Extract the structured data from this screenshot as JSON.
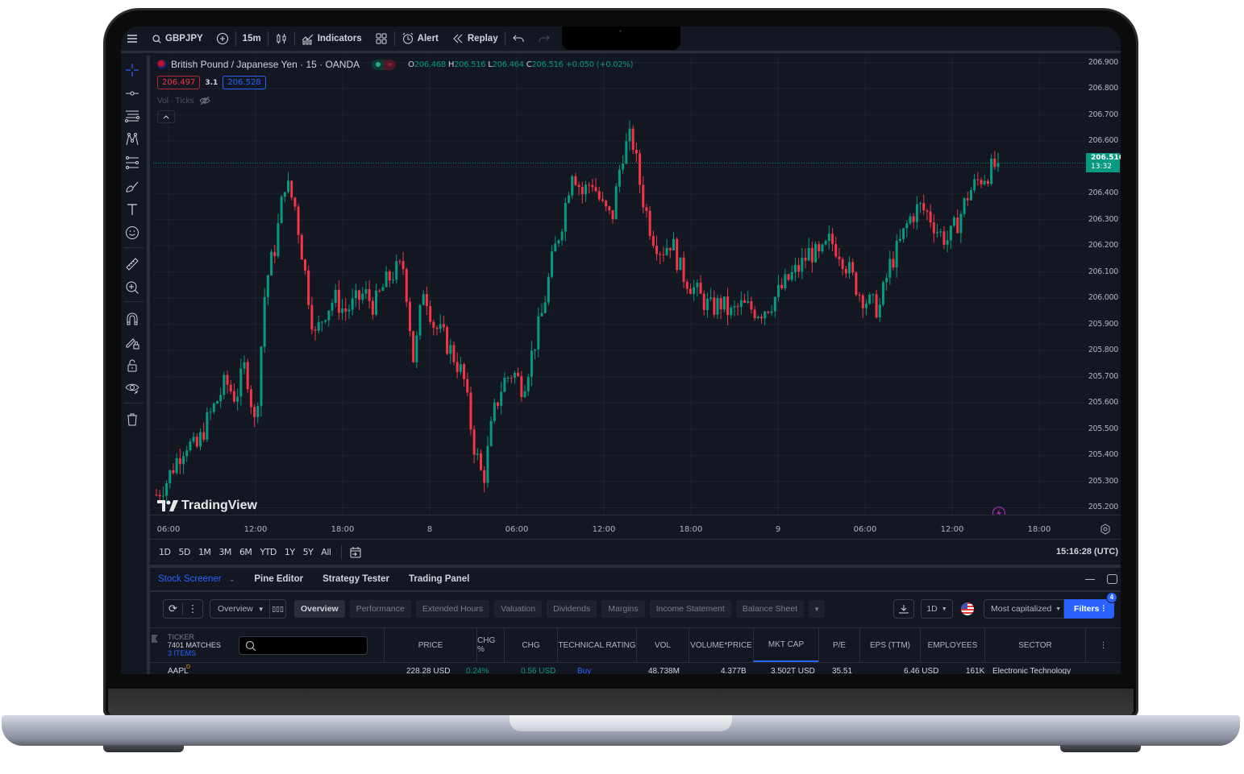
{
  "topbar": {
    "symbol": "GBPJPY",
    "interval": "15m",
    "indicators_label": "Indicators",
    "alert_label": "Alert",
    "replay_label": "Replay",
    "icons": [
      "menu-icon",
      "search-icon",
      "add-symbol-icon",
      "candles-icon",
      "indicators-icon",
      "layouts-icon",
      "alert-icon",
      "replay-icon",
      "undo-icon",
      "redo-icon"
    ]
  },
  "legend": {
    "title": "British Pound / Japanese Yen · 15 · OANDA",
    "ohlc": {
      "o_label": "O",
      "o": "206.468",
      "h_label": "H",
      "h": "206.516",
      "l_label": "L",
      "l": "206.464",
      "c_label": "C",
      "c": "206.516",
      "change": "+0.050 (+0.02%)"
    },
    "bid": "206.497",
    "spread": "3.1",
    "ask": "206.528",
    "volume_label": "Vol · Ticks"
  },
  "left_toolbar": {
    "icons": [
      "crosshair-icon",
      "horizontal-line-icon",
      "fib-icon",
      "pattern-icon",
      "projection-icon",
      "brush-icon",
      "text-icon",
      "emoji-icon",
      "ruler-icon",
      "zoom-in-icon",
      "magnet-icon",
      "lock-drawing-icon",
      "lock-icon",
      "eye-icon",
      "trash-icon"
    ]
  },
  "chart_data": {
    "type": "candlestick",
    "title": "British Pound / Japanese Yen · 15 · OANDA",
    "y_ticks": [
      "206.900",
      "206.800",
      "206.700",
      "206.600",
      "206.500",
      "206.400",
      "206.300",
      "206.200",
      "206.100",
      "206.000",
      "205.900",
      "205.800",
      "205.700",
      "205.600",
      "205.500",
      "205.400",
      "205.300",
      "205.200"
    ],
    "ylim": [
      205.18,
      206.92
    ],
    "x_ticks": [
      "06:00",
      "12:00",
      "18:00",
      "8",
      "06:00",
      "12:00",
      "18:00",
      "9",
      "06:00",
      "12:00",
      "18:00"
    ],
    "last_price": "206.516",
    "countdown": "13:32",
    "close_path": [
      205.25,
      205.3,
      205.38,
      205.45,
      205.42,
      205.52,
      205.6,
      205.68,
      205.62,
      205.75,
      205.5,
      206.05,
      206.2,
      206.45,
      206.35,
      206.1,
      205.85,
      205.95,
      206.0,
      205.95,
      205.98,
      206.02,
      205.97,
      206.05,
      206.1,
      206.12,
      205.75,
      206.05,
      205.9,
      205.85,
      205.78,
      205.7,
      205.45,
      205.3,
      205.55,
      205.68,
      205.72,
      205.66,
      205.8,
      205.95,
      206.15,
      206.3,
      206.5,
      206.4,
      206.45,
      206.35,
      206.3,
      206.55,
      206.62,
      206.4,
      206.25,
      206.18,
      206.22,
      206.1,
      206.05,
      206.0,
      205.96,
      205.98,
      205.94,
      205.97,
      205.96,
      205.95,
      205.98,
      206.03,
      206.08,
      206.12,
      206.18,
      206.15,
      206.22,
      206.18,
      206.1,
      206.02,
      205.98,
      205.96,
      206.12,
      206.2,
      206.3,
      206.35,
      206.32,
      206.25,
      206.22,
      206.3,
      206.4,
      206.45,
      206.48,
      206.516
    ],
    "colors": {
      "up": "#089981",
      "down": "#f23645"
    }
  },
  "watermark": "TradingView",
  "time_ranges": [
    "1D",
    "5D",
    "1M",
    "3M",
    "6M",
    "YTD",
    "1Y",
    "5Y",
    "All"
  ],
  "clock": "15:16:28 (UTC)",
  "bottom_tabs": [
    "Stock Screener",
    "Pine Editor",
    "Strategy Tester",
    "Trading Panel"
  ],
  "screener": {
    "preset": "Overview",
    "categories": [
      "Overview",
      "Performance",
      "Extended Hours",
      "Valuation",
      "Dividends",
      "Margins",
      "Income Statement",
      "Balance Sheet"
    ],
    "interval": "1D",
    "sort_label": "Most capitalized",
    "filters_label": "Filters",
    "filters_count": "4",
    "ticker_header": "TICKER",
    "matches": "7401 MATCHES",
    "items": "3 ITEMS",
    "search_placeholder": "",
    "columns": [
      "PRICE",
      "CHG %",
      "CHG",
      "TECHNICAL RATING",
      "VOL",
      "VOLUME*PRICE",
      "MKT CAP",
      "P/E",
      "EPS (TTM)",
      "EMPLOYEES",
      "SECTOR"
    ],
    "sorted_column": "MKT CAP",
    "rows": [
      {
        "ticker": "AAPL",
        "badge": "D",
        "price": "228.28",
        "price_unit": "USD",
        "chg_pct": "0.24%",
        "chg": "0.56",
        "chg_unit": "USD",
        "rating": "Buy",
        "vol": "48.738M",
        "vol_price": "4.377B",
        "mkt_cap": "3.502T",
        "mkt_cap_unit": "USD",
        "pe": "35.51",
        "eps": "6.46",
        "eps_unit": "USD",
        "employees": "161K",
        "sector": "Electronic Technology"
      }
    ]
  },
  "colors": {
    "accent": "#2962ff",
    "up": "#089981",
    "down": "#f23645",
    "background": "#131722",
    "border": "#2a2e39"
  }
}
